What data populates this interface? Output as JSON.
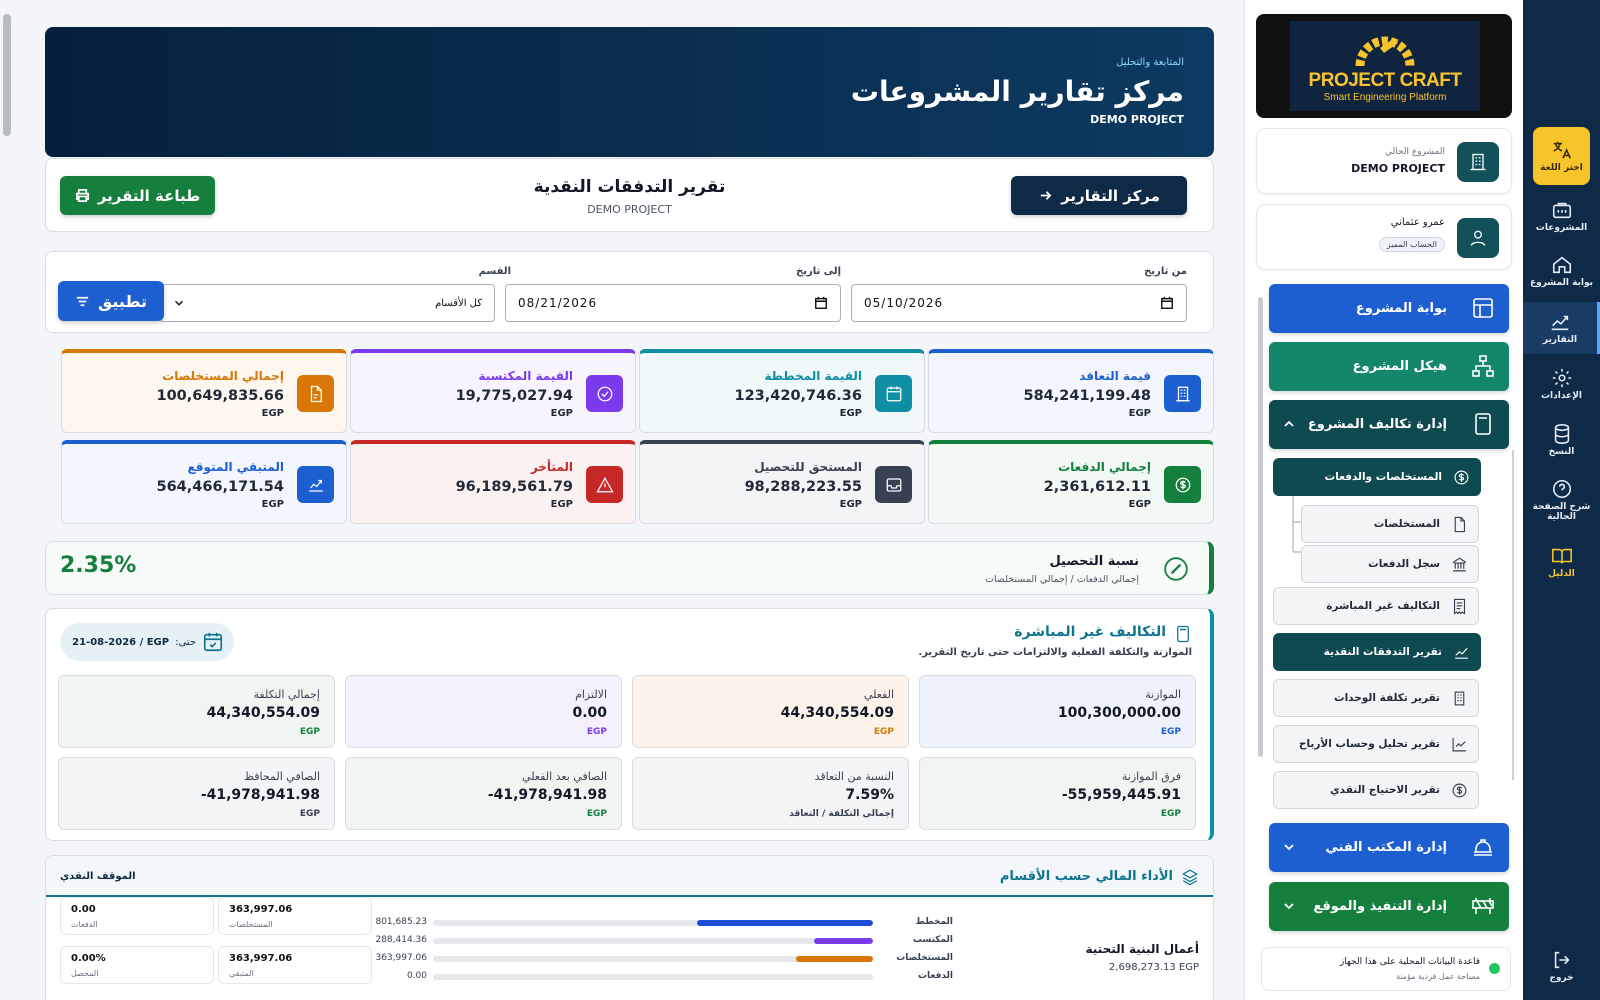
{
  "rail": {
    "language": "اختر اللغة",
    "projects": "المشروعات",
    "portal": "بوابة المشروع",
    "reports": "التقارير",
    "settings": "الإعدادات",
    "backup": "النسخ",
    "explain": "شرح الصفحة الحالية",
    "guide": "الدليل",
    "logout": "خروج"
  },
  "logo": {
    "name": "PROJECT CRAFT",
    "tagline": "Smart Engineering Platform"
  },
  "current_project": {
    "label": "المشروع الحالي",
    "name": "DEMO PROJECT"
  },
  "user": {
    "name": "عمرو عثماني",
    "badge": "الحساب المميز"
  },
  "nav": {
    "portal": "بوابة المشروع",
    "structure": "هيكل المشروع",
    "costs": "إدارة تكاليف المشروع",
    "claims_payments": "المستخلصات والدفعات",
    "claims": "المستخلصات",
    "payments_log": "سجل الدفعات",
    "indirect": "التكاليف غير المباشرة",
    "cashflow": "تقرير التدفقات النقدية",
    "unit_cost": "تقرير تكلفة الوحدات",
    "profit": "تقرير تحليل وحساب الأرباح",
    "cash_need": "تقرير الاحتياج النقدي",
    "tech_office": "إدارة المكتب الفني",
    "execution": "إدارة التنفيذ والموقع"
  },
  "db": {
    "title": "قاعدة البيانات المحلية على هذا الجهاز",
    "sub": "مساحة عمل فردية مؤمنة"
  },
  "header": {
    "kicker": "المتابعة والتحليل",
    "title": "مركز تقارير المشروعات",
    "project": "DEMO PROJECT"
  },
  "toolbar": {
    "back": "مركز التقارير",
    "report_title": "تقرير التدفقات النقدية",
    "project": "DEMO PROJECT",
    "print": "طباعة التقرير"
  },
  "filters": {
    "from_label": "من تاريخ",
    "from_value": "05/10/2026",
    "to_label": "إلى تاريخ",
    "to_value": "08/21/2026",
    "dept_label": "القسم",
    "dept_value": "كل الأقسام",
    "apply": "تطبيق"
  },
  "kpis": [
    {
      "label": "قيمة التعاقد",
      "value": "584,241,199.48",
      "currency": "EGP",
      "color": "#1d5fd1"
    },
    {
      "label": "القيمة المخططة",
      "value": "123,420,746.36",
      "currency": "EGP",
      "color": "#0e8fa3"
    },
    {
      "label": "القيمة المكتسبة",
      "value": "19,775,027.94",
      "currency": "EGP",
      "color": "#7c3aed"
    },
    {
      "label": "إجمالي المستخلصات",
      "value": "100,649,835.66",
      "currency": "EGP",
      "color": "#d97706"
    },
    {
      "label": "إجمالي الدفعات",
      "value": "2,361,612.11",
      "currency": "EGP",
      "color": "#15803d"
    },
    {
      "label": "المستحق للتحصيل",
      "value": "98,288,223.55",
      "currency": "EGP",
      "color": "#374151"
    },
    {
      "label": "المتأخر",
      "value": "96,189,561.79",
      "currency": "EGP",
      "color": "#c62828"
    },
    {
      "label": "المتبقي المتوقع",
      "value": "564,466,171.54",
      "currency": "EGP",
      "color": "#1d5fd1"
    }
  ],
  "collection": {
    "title": "نسبة التحصيل",
    "sub": "إجمالي الدفعات / إجمالي المستخلصات",
    "value": "2.35%"
  },
  "indirect": {
    "title": "التكاليف غير المباشرة",
    "sub": "الموازنة والتكلفة الفعلية والالتزامات حتى تاريخ التقرير.",
    "until_label": "حتى:",
    "until_value": "21-08-2026 / EGP",
    "cards": [
      {
        "label": "الموازنة",
        "value": "100,300,000.00",
        "note": "EGP",
        "bg": "#eef3fb",
        "nc": "#1d5fd1"
      },
      {
        "label": "الفعلي",
        "value": "44,340,554.09",
        "note": "EGP",
        "bg": "#fdf3ea",
        "nc": "#d97706"
      },
      {
        "label": "الالتزام",
        "value": "0.00",
        "note": "EGP",
        "bg": "#f4f0fc",
        "nc": "#7c3aed"
      },
      {
        "label": "إجمالي التكلفة",
        "value": "44,340,554.09",
        "note": "EGP",
        "bg": "#f1f5f2",
        "nc": "#15803d"
      },
      {
        "label": "فرق الموازنة",
        "value": "-55,959,445.91",
        "note": "EGP",
        "bg": "#f1f5f2",
        "nc": "#15803d"
      },
      {
        "label": "النسبة من التعاقد",
        "value": "7.59%",
        "note": "إجمالي التكلفة / التعاقد",
        "bg": "#f3f4f6",
        "nc": "#374151"
      },
      {
        "label": "الصافي بعد الفعلي",
        "value": "-41,978,941.98",
        "note": "EGP",
        "bg": "#f1f5f2",
        "nc": "#15803d"
      },
      {
        "label": "الصافي المحافظ",
        "value": "-41,978,941.98",
        "note": "EGP",
        "bg": "#f3f4f6",
        "nc": "#374151"
      }
    ]
  },
  "performance": {
    "title": "الأداء المالي حسب الأقسام",
    "right_label": "الموقف النقدي",
    "section_name": "أعمال البنية التحتية",
    "section_total": "2,698,273.13 EGP",
    "bars": [
      {
        "label": "المخطط",
        "value": "801,685.23",
        "fraction": 0.4,
        "color": "#1d4ed8"
      },
      {
        "label": "المكتسب",
        "value": "288,414.36",
        "fraction": 0.135,
        "color": "#7c3aed"
      },
      {
        "label": "المستخلصات",
        "value": "363,997.06",
        "fraction": 0.175,
        "color": "#d97706"
      },
      {
        "label": "الدفعات",
        "value": "0.00",
        "fraction": 0,
        "color": "#15803d"
      }
    ],
    "stats": [
      {
        "value": "363,997.06",
        "label": "المستخلصات"
      },
      {
        "value": "0.00",
        "label": "الدفعات"
      },
      {
        "value": "363,997.06",
        "label": "المتبقي"
      },
      {
        "value": "0.00%",
        "label": "المحصل"
      }
    ]
  }
}
